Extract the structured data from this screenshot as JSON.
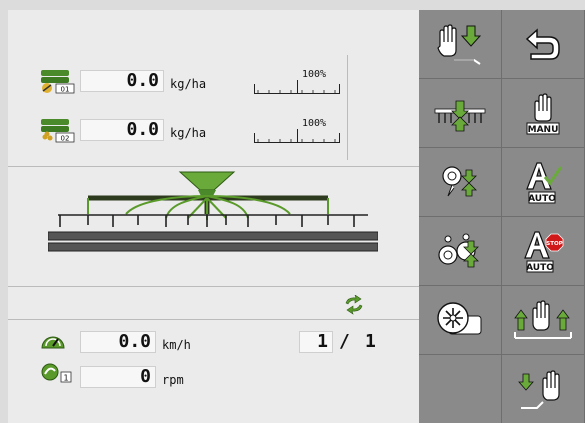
{
  "rates": [
    {
      "value": "0.0",
      "unit": "kg/ha",
      "percent": "100%",
      "tank_badge": "01"
    },
    {
      "value": "0.0",
      "unit": "kg/ha",
      "percent": "100%",
      "tank_badge": "02"
    }
  ],
  "speed": {
    "value": "0.0",
    "unit": "km/h"
  },
  "rpm": {
    "value": "0",
    "unit": "rpm",
    "badge": "1"
  },
  "section": {
    "current": "1",
    "separator": "/",
    "total": "1"
  },
  "side_buttons": {
    "manu_label": "MANU",
    "auto_label": "AUTO",
    "auto_label_2": "AUTO",
    "stop_label": "STOP"
  },
  "colors": {
    "accent_green": "#5a9a2a",
    "frame_dark": "#2e3a1e",
    "panel_right": "#8a8a8a"
  }
}
